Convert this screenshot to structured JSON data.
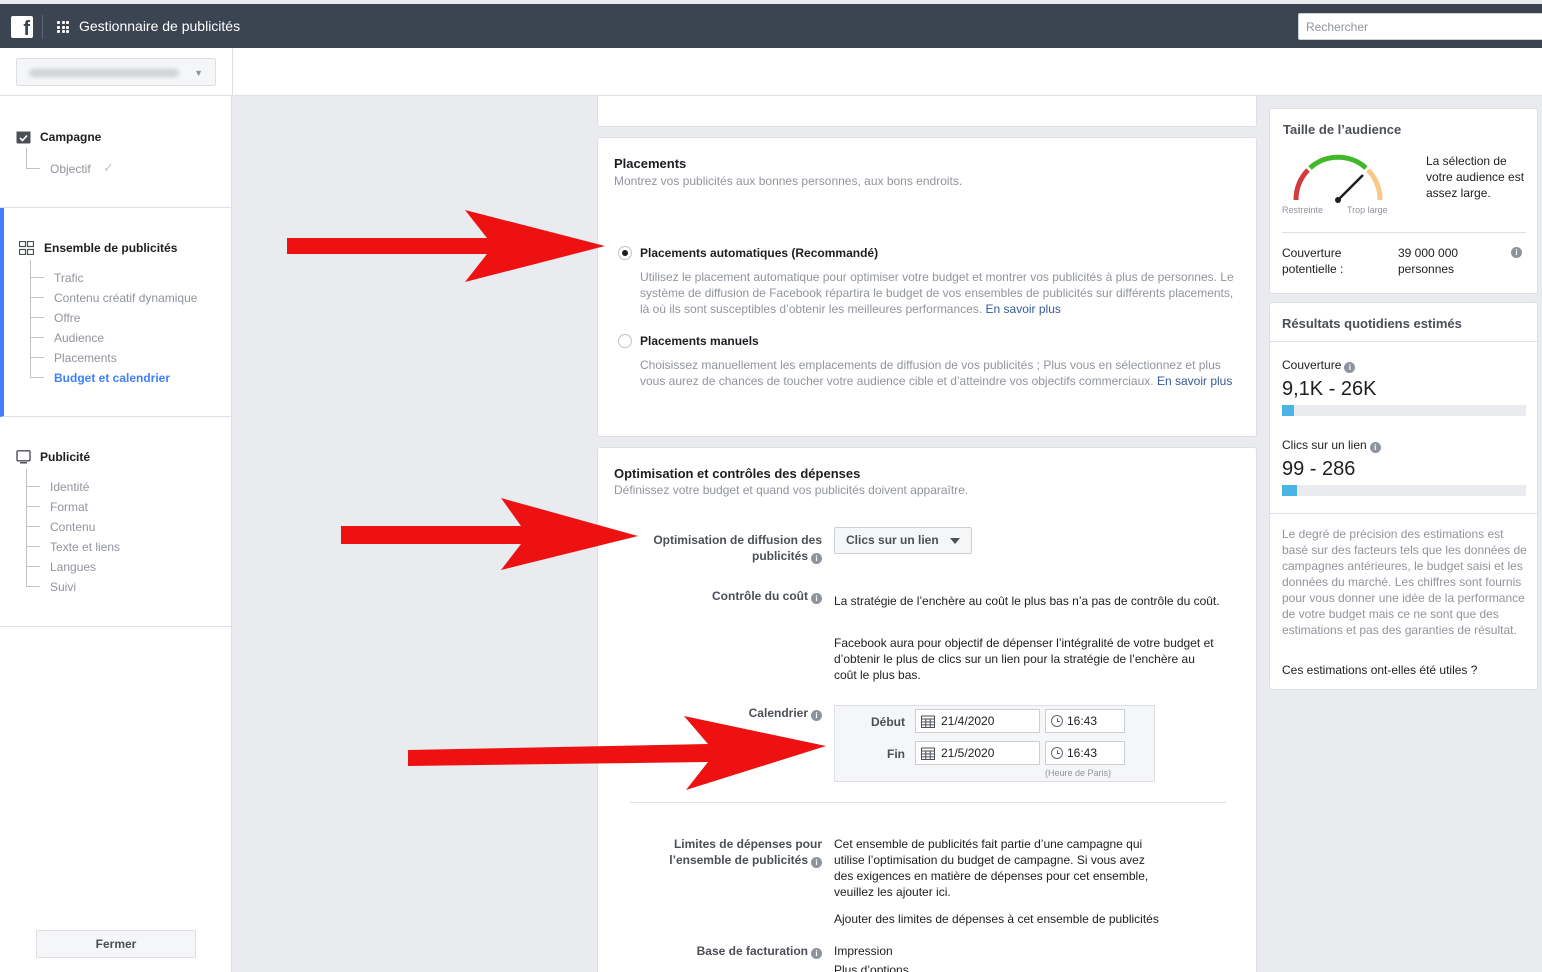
{
  "topbar": {
    "logo": "f",
    "app_title": "Gestionnaire de publicités",
    "search_placeholder": "Rechercher"
  },
  "sidebar": {
    "campaign": {
      "title": "Campagne",
      "items": [
        "Objectif"
      ]
    },
    "adset": {
      "title": "Ensemble de publicités",
      "items": [
        "Trafic",
        "Contenu créatif dynamique",
        "Offre",
        "Audience",
        "Placements",
        "Budget et calendrier"
      ],
      "current": "Budget et calendrier"
    },
    "ad": {
      "title": "Publicité",
      "items": [
        "Identité",
        "Format",
        "Contenu",
        "Texte et liens",
        "Langues",
        "Suivi"
      ]
    },
    "close_label": "Fermer"
  },
  "placements": {
    "title": "Placements",
    "subtitle": "Montrez vos publicités aux bonnes personnes, aux bons endroits.",
    "auto": {
      "label": "Placements automatiques (Recommandé)",
      "desc": "Utilisez le placement automatique pour optimiser votre budget et montrer vos publicités à plus de personnes. Le système de diffusion de Facebook répartira le budget de vos ensembles de publicités sur différents placements, là où ils sont susceptibles d’obtenir les meilleures performances.",
      "link": "En savoir plus",
      "selected": true
    },
    "manual": {
      "label": "Placements manuels",
      "desc": "Choisissez manuellement les emplacements de diffusion de vos publicités ; Plus vous en sélectionnez et plus vous aurez de chances de toucher votre audience cible et d’atteindre vos objectifs commerciaux.",
      "link": "En savoir plus",
      "selected": false
    }
  },
  "optimization": {
    "title": "Optimisation et contrôles des dépenses",
    "subtitle": "Définissez votre budget et quand vos publicités doivent apparaître.",
    "delivery_label_1": "Optimisation de diffusion des",
    "delivery_label_2": "publicités",
    "delivery_value": "Clics sur un lien",
    "cost_label": "Contrôle du coût",
    "cost_text_1": "La stratégie de l’enchère au coût le plus bas n’a pas de contrôle du coût.",
    "cost_text_2": "Facebook aura pour objectif de dépenser l’intégralité de votre budget et d’obtenir le plus de clics sur un lien pour la stratégie de l’enchère au coût le plus bas.",
    "schedule_label": "Calendrier",
    "start_label": "Début",
    "start_date": "21/4/2020",
    "start_time": "16:43",
    "end_label": "Fin",
    "end_date": "21/5/2020",
    "end_time": "16:43",
    "timezone": "(Heure de Paris)",
    "limits_label_1": "Limites de dépenses pour",
    "limits_label_2": "l’ensemble de publicités",
    "limits_text": "Cet ensemble de publicités fait partie d’une campagne qui utilise l’optimisation du budget de campagne. Si vous avez des exigences en matière de dépenses pour cet ensemble, veuillez les ajouter ici.",
    "limits_link": "Ajouter des limites de dépenses à cet ensemble de publicités",
    "billing_label": "Base de facturation",
    "billing_value": "Impression",
    "billing_more": "Plus d’options"
  },
  "audience": {
    "title": "Taille de l’audience",
    "gauge_desc": "La sélection de votre audience est assez large.",
    "gauge_left": "Restreinte",
    "gauge_right": "Trop large",
    "reach_label": "Couverture potentielle :",
    "reach_value": "39 000 000 personnes"
  },
  "estimates": {
    "title": "Résultats quotidiens estimés",
    "reach_label": "Couverture",
    "reach_value": "9,1K - 26K",
    "reach_fill": 0.05,
    "clicks_label": "Clics sur un lien",
    "clicks_value": "99 - 286",
    "clicks_fill": 0.06,
    "disclaimer": "Le degré de précision des estimations est basé sur des facteurs tels que les données de campagnes antérieures, le budget saisi et les données du marché. Les chiffres sont fournis pour vous donner une idée de la performance de votre budget mais ce ne sont que des estimations et pas des garanties de résultat.",
    "feedback_link": "Ces estimations ont-elles été utiles ?"
  },
  "colors": {
    "topbar": "#3b4552",
    "accent": "#4080ff",
    "link": "#365899",
    "arrow": "#ee1111",
    "bar": "#4cb3e5"
  }
}
